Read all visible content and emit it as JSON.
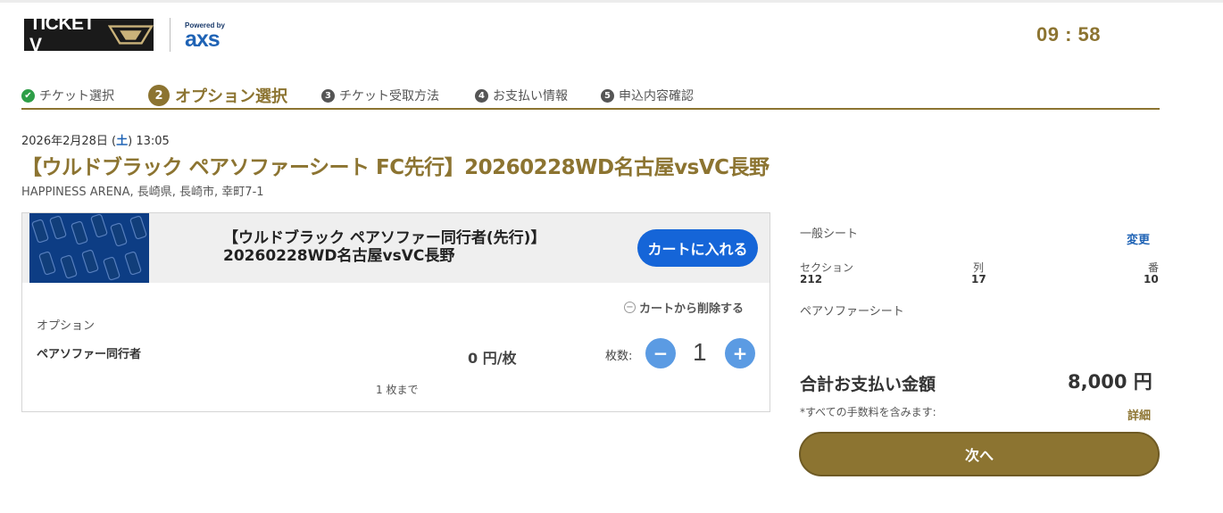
{
  "header": {
    "logo_text": "TICKET V",
    "powered_by": "Powered by",
    "axs_logo": "axs",
    "timer": "09 : 58"
  },
  "steps": [
    {
      "number": "",
      "label": "チケット選択",
      "state": "done",
      "icon": "check-icon"
    },
    {
      "number": "2",
      "label": "オプション選択",
      "state": "active"
    },
    {
      "number": "3",
      "label": "チケット受取方法",
      "state": "pending"
    },
    {
      "number": "4",
      "label": "お支払い情報",
      "state": "pending"
    },
    {
      "number": "5",
      "label": "申込内容確認",
      "state": "pending"
    }
  ],
  "event": {
    "date_prefix": "2026年2月28日 (",
    "day_of_week": "土",
    "date_suffix": ") 13:05",
    "title": "【ウルドブラック ペアソファーシート FC先行】20260228WD名古屋vsVC長野",
    "venue": "HAPPINESS ARENA, 長崎県, 長崎市, 幸町7-1"
  },
  "product": {
    "name": "【ウルドブラック ペアソファー同行者(先行)】20260228WD名古屋vsVC長野",
    "add_to_cart_label": "カートに入れる",
    "remove_label": "カートから削除する",
    "option_heading": "オプション",
    "option_name": "ペアソファー同行者",
    "price": "0 円/枚",
    "quantity_label": "枚数:",
    "quantity": "1",
    "limit_text": "1 枚まで"
  },
  "summary": {
    "seat_type": "一般シート",
    "change_label": "変更",
    "section_label": "セクション",
    "section_value": "212",
    "row_label": "列",
    "row_value": "17",
    "seat_label": "番",
    "seat_value": "10",
    "seat_name": "ペアソファーシート",
    "total_label": "合計お支払い金額",
    "total_value": "8,000 円",
    "fee_note": "*すべての手数料を含みます:",
    "detail_label": "詳細",
    "next_label": "次へ"
  },
  "colors": {
    "gold": "#8c7431",
    "blue": "#1565d8",
    "green_check": "#2e9e48",
    "qty_button": "#5b9be3"
  }
}
